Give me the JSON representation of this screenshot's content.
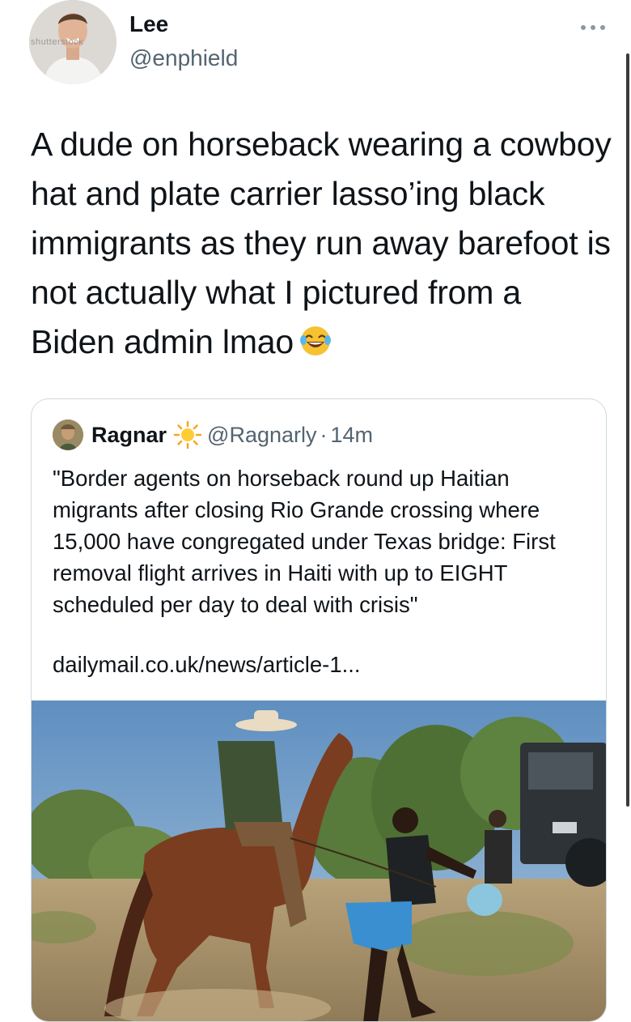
{
  "tweet": {
    "author_name": "Lee",
    "author_handle": "@enphield",
    "avatar_watermark": "shutterstock",
    "text": "A dude on horseback wearing a cowboy hat and plate carrier lasso’ing black immigrants as they run away barefoot is not actually what I pictured from a Biden admin lmao",
    "text_emoji": "laughing-face-emoji"
  },
  "quote": {
    "author_name": "Ragnar",
    "name_emoji": "sun-icon",
    "author_handle": "@Ragnarly",
    "separator": "·",
    "time": "14m",
    "text": "\"Border agents on horseback round up Haitian migrants after closing Rio Grande crossing where 15,000 have congregated under Texas bridge: First removal flight arrives in Haiti with up to EIGHT scheduled per day to deal with crisis\"",
    "link": "dailymail.co.uk/news/article-1..."
  },
  "colors": {
    "text": "#0f1419",
    "secondary": "#536471",
    "border": "#cfd9de"
  }
}
